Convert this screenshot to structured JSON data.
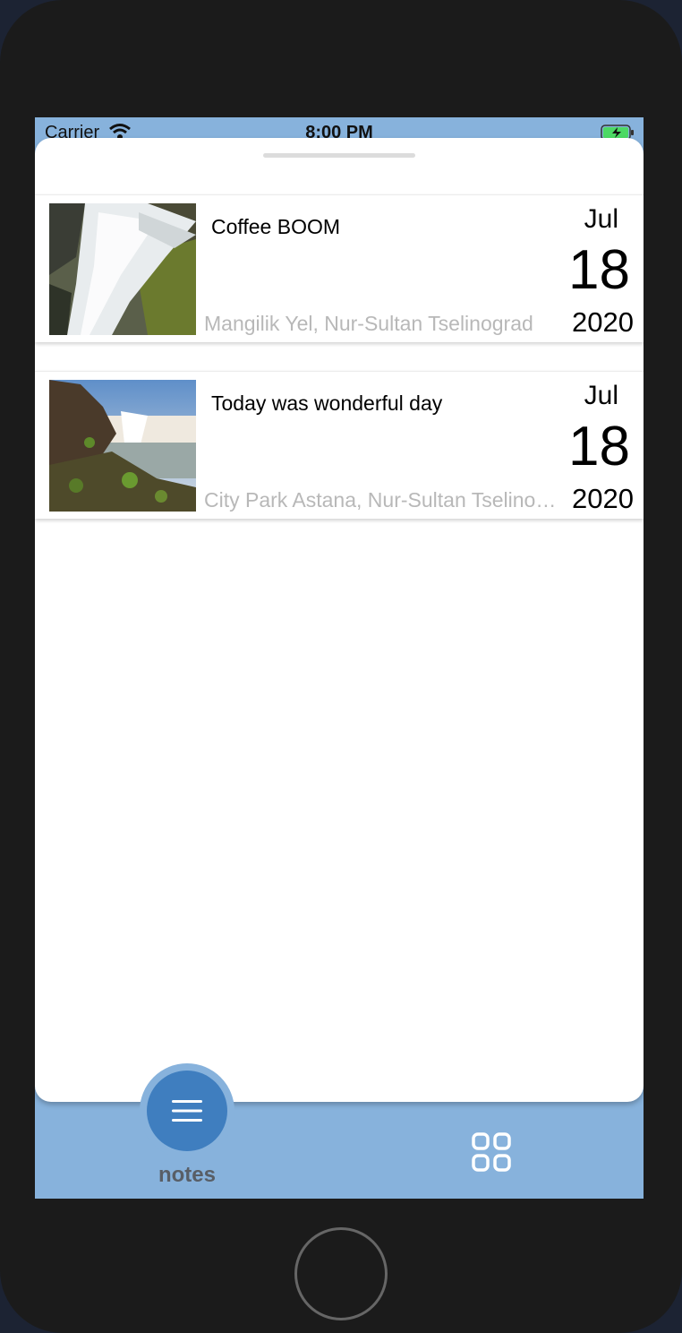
{
  "status_bar": {
    "carrier": "Carrier",
    "time": "8:00 PM",
    "icons": [
      "wifi-icon",
      "battery-charging-icon"
    ]
  },
  "notes": [
    {
      "title": "Coffee BOOM",
      "location": "Mangilik Yel, Nur-Sultan Tselinograd",
      "month": "Jul",
      "day": "18",
      "year": "2020",
      "thumbnail": "waterfall-over-mossy-rocks"
    },
    {
      "title": "Today was wonderful day",
      "location": "City Park Astana, Nur-Sultan Tselinograd",
      "month": "Jul",
      "day": "18",
      "year": "2020",
      "thumbnail": "waterfall-landscape-with-cliff"
    }
  ],
  "tabbar": {
    "notes_label": "notes",
    "icons": [
      "menu-icon",
      "grid-icon"
    ]
  },
  "colors": {
    "accent": "#3f7ebf",
    "tabbar_bg": "#87b2dc",
    "location_text": "#b8b8b8"
  }
}
